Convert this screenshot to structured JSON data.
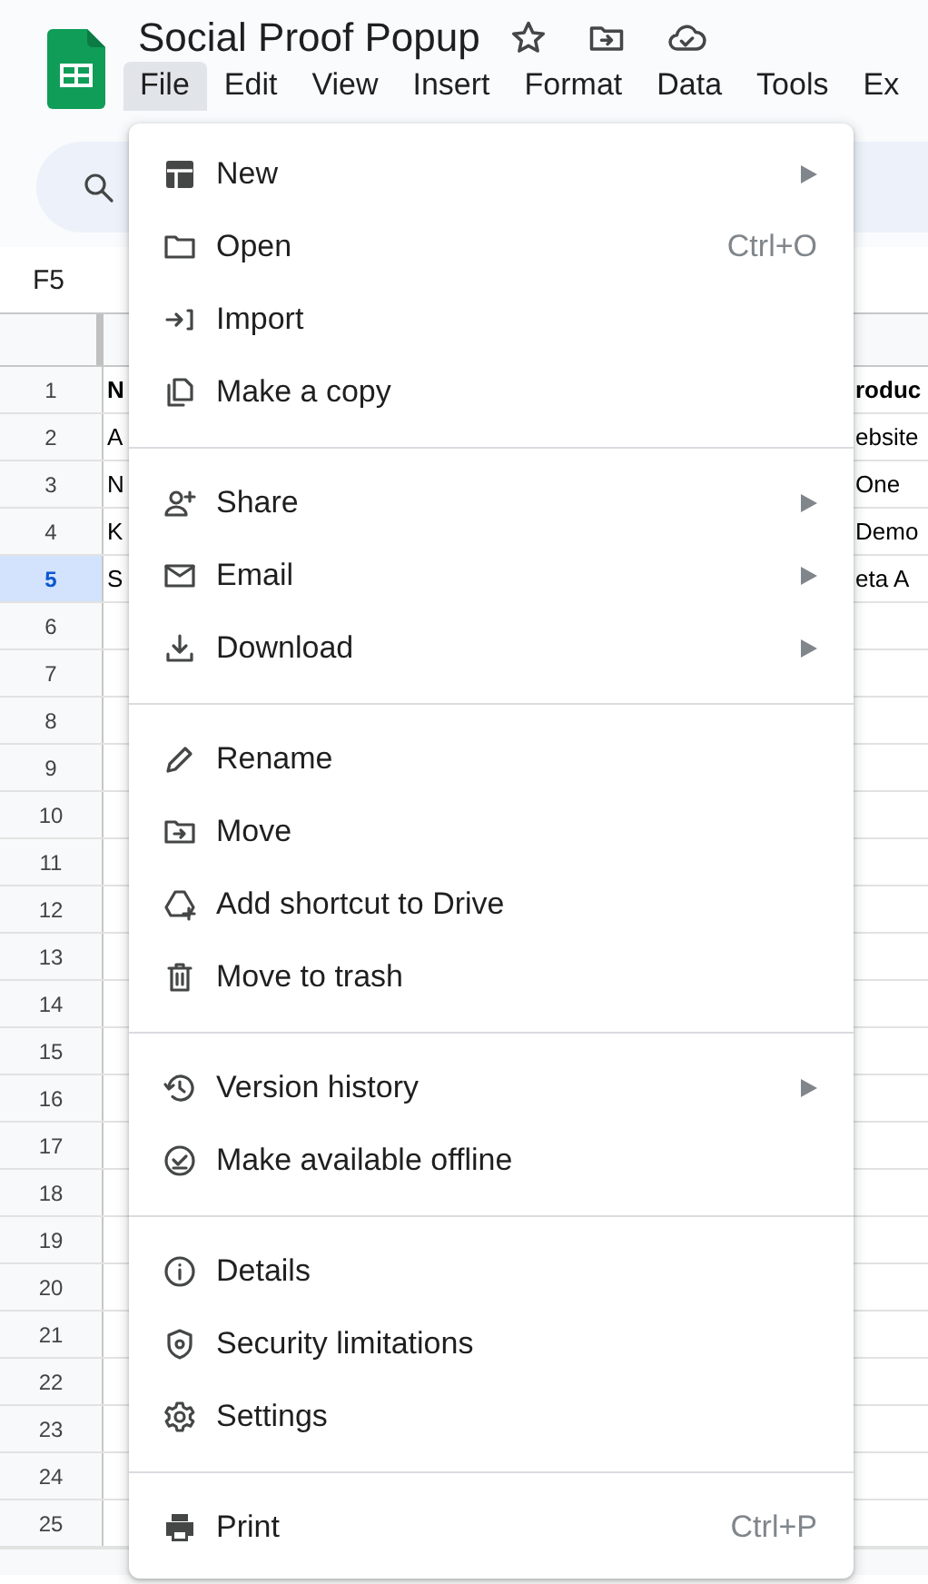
{
  "document": {
    "title": "Social Proof Popup"
  },
  "menubar": [
    {
      "label": "File",
      "selected": true
    },
    {
      "label": "Edit",
      "selected": false
    },
    {
      "label": "View",
      "selected": false
    },
    {
      "label": "Insert",
      "selected": false
    },
    {
      "label": "Format",
      "selected": false
    },
    {
      "label": "Data",
      "selected": false
    },
    {
      "label": "Tools",
      "selected": false
    },
    {
      "label": "Ex",
      "selected": false
    }
  ],
  "name_box": "F5",
  "rows": [
    {
      "number": "1",
      "selected": false,
      "bold": true,
      "cells": [
        "N",
        "roduc"
      ]
    },
    {
      "number": "2",
      "selected": false,
      "bold": false,
      "cells": [
        "A",
        "ebsite"
      ]
    },
    {
      "number": "3",
      "selected": false,
      "bold": false,
      "cells": [
        "N",
        "One"
      ]
    },
    {
      "number": "4",
      "selected": false,
      "bold": false,
      "cells": [
        "K",
        "Demo"
      ]
    },
    {
      "number": "5",
      "selected": true,
      "bold": false,
      "cells": [
        "S",
        "eta A"
      ]
    },
    {
      "number": "6",
      "selected": false
    },
    {
      "number": "7",
      "selected": false
    },
    {
      "number": "8",
      "selected": false
    },
    {
      "number": "9",
      "selected": false
    },
    {
      "number": "10",
      "selected": false
    },
    {
      "number": "11",
      "selected": false
    },
    {
      "number": "12",
      "selected": false
    },
    {
      "number": "13",
      "selected": false
    },
    {
      "number": "14",
      "selected": false
    },
    {
      "number": "15",
      "selected": false
    },
    {
      "number": "16",
      "selected": false
    },
    {
      "number": "17",
      "selected": false
    },
    {
      "number": "18",
      "selected": false
    },
    {
      "number": "19",
      "selected": false
    },
    {
      "number": "20",
      "selected": false
    },
    {
      "number": "21",
      "selected": false
    },
    {
      "number": "22",
      "selected": false
    },
    {
      "number": "23",
      "selected": false
    },
    {
      "number": "24",
      "selected": false
    },
    {
      "number": "25",
      "selected": false
    }
  ],
  "file_menu": {
    "groups": [
      [
        {
          "label": "New",
          "submenu": true
        },
        {
          "label": "Open",
          "shortcut": "Ctrl+O",
          "submenu": false
        },
        {
          "label": "Import",
          "submenu": false
        },
        {
          "label": "Make a copy",
          "submenu": false
        }
      ],
      [
        {
          "label": "Share",
          "submenu": true
        },
        {
          "label": "Email",
          "submenu": true
        },
        {
          "label": "Download",
          "submenu": true
        }
      ],
      [
        {
          "label": "Rename",
          "submenu": false
        },
        {
          "label": "Move",
          "submenu": false
        },
        {
          "label": "Add shortcut to Drive",
          "submenu": false
        },
        {
          "label": "Move to trash",
          "submenu": false
        }
      ],
      [
        {
          "label": "Version history",
          "submenu": true
        },
        {
          "label": "Make available offline",
          "submenu": false
        }
      ],
      [
        {
          "label": "Details",
          "submenu": false
        },
        {
          "label": "Security limitations",
          "submenu": false
        },
        {
          "label": "Settings",
          "submenu": false
        }
      ],
      [
        {
          "label": "Print",
          "shortcut": "Ctrl+P",
          "submenu": false
        }
      ]
    ]
  }
}
